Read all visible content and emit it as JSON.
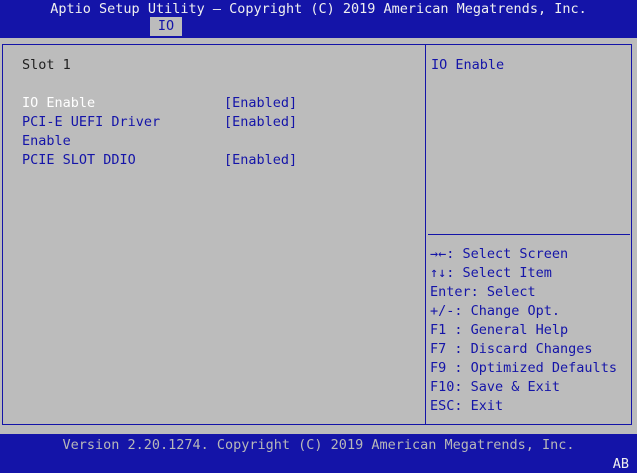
{
  "header": {
    "title": "Aptio Setup Utility – Copyright (C) 2019 American Megatrends, Inc.",
    "tab": "IO"
  },
  "main": {
    "section_title": "Slot 1",
    "items": [
      {
        "label": "IO Enable",
        "value": "[Enabled]"
      },
      {
        "label_line1": "PCI-E UEFI Driver",
        "label_line2": "Enable",
        "value": "[Enabled]"
      },
      {
        "label": "PCIE SLOT DDIO",
        "value": "[Enabled]"
      }
    ]
  },
  "help": {
    "text": "IO Enable"
  },
  "keys": [
    {
      "key": "→←",
      "action": ": Select Screen"
    },
    {
      "key": "↑↓",
      "action": ": Select Item"
    },
    {
      "key": "Enter",
      "action": ": Select"
    },
    {
      "key": "+/-",
      "action": ": Change Opt."
    },
    {
      "key": "F1 ",
      "action": ": General Help"
    },
    {
      "key": "F7 ",
      "action": ": Discard Changes"
    },
    {
      "key": "F9 ",
      "action": ": Optimized Defaults"
    },
    {
      "key": "F10",
      "action": ": Save & Exit"
    },
    {
      "key": "ESC",
      "action": ": Exit"
    }
  ],
  "footer": {
    "version": "Version 2.20.1274. Copyright (C) 2019 American Megatrends, Inc.",
    "badge": "AB"
  },
  "colors": {
    "bar_blue": "#1414a8",
    "panel_gray": "#bcbcbc",
    "highlight_white": "#ffffff"
  }
}
